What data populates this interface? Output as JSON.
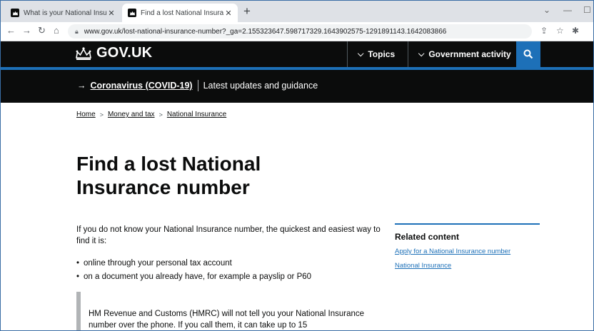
{
  "browser": {
    "tabs": [
      {
        "title": "What is your National Insurance",
        "active": false
      },
      {
        "title": "Find a lost National Insurance nu",
        "active": true
      }
    ],
    "url": "www.gov.uk/lost-national-insurance-number?_ga=2.155323647.598717329.1643902575-1291891143.1642083866"
  },
  "header": {
    "logo_text": "GOV.UK",
    "nav": [
      {
        "label": "Topics"
      },
      {
        "label": "Government activity"
      }
    ]
  },
  "banner": {
    "arrow": "→",
    "link": "Coronavirus (COVID-19)",
    "text": "Latest updates and guidance"
  },
  "breadcrumbs": [
    {
      "label": "Home"
    },
    {
      "label": "Money and tax"
    },
    {
      "label": "National Insurance"
    }
  ],
  "page": {
    "title_line1": "Find a lost National",
    "title_line2": "Insurance number",
    "intro": "If you do not know your National Insurance number, the quickest and easiest way to find it is:",
    "bullets": [
      "online through your personal tax account",
      "on a document you already have, for example a payslip or P60"
    ],
    "inset": "HM Revenue and Customs (HMRC) will not tell you your National Insurance number over the phone. If you call them, it can take up to 15"
  },
  "related": {
    "title": "Related content",
    "links": [
      {
        "label": "Apply for a National Insurance number"
      },
      {
        "label": "National Insurance"
      }
    ]
  },
  "colors": {
    "govuk_black": "#0b0c0c",
    "govuk_blue": "#1d70b8"
  }
}
